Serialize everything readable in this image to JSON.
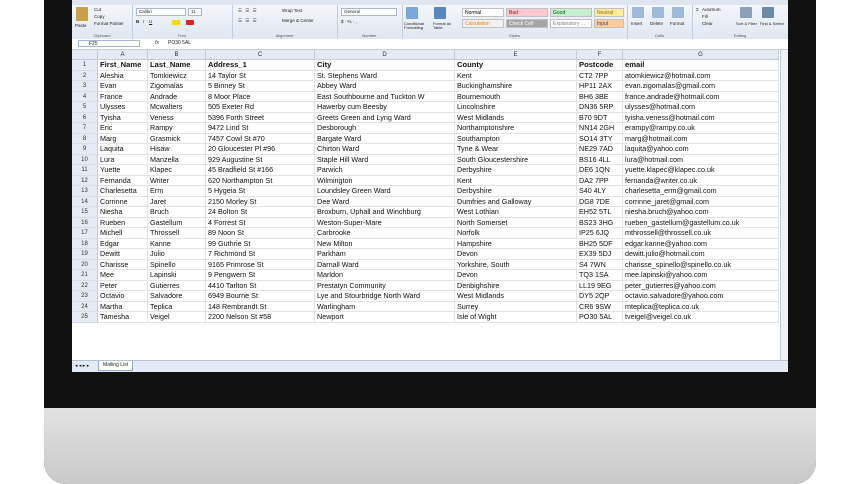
{
  "ribbon": {
    "clipboard": {
      "paste": "Paste",
      "cut": "Cut",
      "copy": "Copy",
      "format_painter": "Format Painter",
      "label": "Clipboard"
    },
    "font": {
      "name": "Calibri",
      "size": "11",
      "label": "Font"
    },
    "alignment": {
      "wrap": "Wrap Text",
      "merge": "Merge & Center",
      "label": "Alignment"
    },
    "number": {
      "format": "General",
      "label": "Number"
    },
    "styles": {
      "conditional": "Conditional Formatting",
      "format_table": "Format as Table",
      "label": "Styles",
      "items": [
        {
          "text": "Normal",
          "bg": "#ffffff",
          "fg": "#000000"
        },
        {
          "text": "Bad",
          "bg": "#ffc7ce",
          "fg": "#9c0006"
        },
        {
          "text": "Good",
          "bg": "#c6efce",
          "fg": "#006100"
        },
        {
          "text": "Neutral",
          "bg": "#ffeb9c",
          "fg": "#9c6500"
        },
        {
          "text": "Calculation",
          "bg": "#f2f2f2",
          "fg": "#fa7d00"
        },
        {
          "text": "Check Cell",
          "bg": "#a5a5a5",
          "fg": "#ffffff"
        },
        {
          "text": "Explanatory ...",
          "bg": "#ffffff",
          "fg": "#7f7f7f"
        },
        {
          "text": "Input",
          "bg": "#ffcc99",
          "fg": "#3f3f76"
        }
      ]
    },
    "cells": {
      "insert": "Insert",
      "delete": "Delete",
      "format": "Format",
      "label": "Cells"
    },
    "editing": {
      "autosum": "AutoSum",
      "fill": "Fill",
      "clear": "Clear",
      "sort": "Sort & Filter",
      "find": "Find & Select",
      "label": "Editing"
    }
  },
  "formula_bar": {
    "name_box": "F25",
    "fx": "fx",
    "value": "PO30 5AL"
  },
  "columns": [
    "A",
    "B",
    "C",
    "D",
    "E",
    "F",
    "G"
  ],
  "rows": [
    [
      "First_Name",
      "Last_Name",
      "Address_1",
      "City",
      "County",
      "Postcode",
      "email"
    ],
    [
      "Aleshia",
      "Tomkiewicz",
      "14 Taylor St",
      "St. Stephens Ward",
      "Kent",
      "CT2 7PP",
      "atomkiewicz@hotmail.com"
    ],
    [
      "Evan",
      "Zigomalas",
      "5 Binney St",
      "Abbey Ward",
      "Buckinghamshire",
      "HP11 2AX",
      "evan.zigomalas@gmail.com"
    ],
    [
      "France",
      "Andrade",
      "8 Moor Place",
      "East Southbourne and Tuckton W",
      "Bournemouth",
      "BH6 3BE",
      "france.andrade@hotmail.com"
    ],
    [
      "Ulysses",
      "Mcwalters",
      "505 Exeter Rd",
      "Hawerby cum Beesby",
      "Lincolnshire",
      "DN36 5RP",
      "ulysses@hotmail.com"
    ],
    [
      "Tyisha",
      "Veness",
      "5396 Forth Street",
      "Greets Green and Lyng Ward",
      "West Midlands",
      "B70 9DT",
      "tyisha.veness@hotmail.com"
    ],
    [
      "Eric",
      "Rampy",
      "9472 Lind St",
      "Desborough",
      "Northamptonshire",
      "NN14 2GH",
      "erampy@rampy.co.uk"
    ],
    [
      "Marg",
      "Grasmick",
      "7457 Cowl St #70",
      "Bargate Ward",
      "Southampton",
      "SO14 3TY",
      "marg@hotmail.com"
    ],
    [
      "Laquita",
      "Hisaw",
      "20 Gloucester Pl #96",
      "Chirton Ward",
      "Tyne & Wear",
      "NE29 7AD",
      "laquita@yahoo.com"
    ],
    [
      "Lura",
      "Manzella",
      "929 Augustine St",
      "Staple Hill Ward",
      "South Gloucestershire",
      "BS16 4LL",
      "lura@hotmail.com"
    ],
    [
      "Yuette",
      "Klapec",
      "45 Bradfield St #166",
      "Parwich",
      "Derbyshire",
      "DE6 1QN",
      "yuette.klapec@klapec.co.uk"
    ],
    [
      "Fernanda",
      "Writer",
      "620 Northampton St",
      "Wilmington",
      "Kent",
      "DA2 7PP",
      "fernanda@writer.co.uk"
    ],
    [
      "Charlesetta",
      "Erm",
      "5 Hygeia St",
      "Loundsley Green Ward",
      "Derbyshire",
      "S40 4LY",
      "charlesetta_erm@gmail.com"
    ],
    [
      "Corrinne",
      "Jaret",
      "2150 Morley St",
      "Dee Ward",
      "Dumfries and Galloway",
      "DG8 7DE",
      "corrinne_jaret@gmail.com"
    ],
    [
      "Niesha",
      "Bruch",
      "24 Bolton St",
      "Broxburn, Uphall and Winchburg",
      "West Lothian",
      "EH52 5TL",
      "niesha.bruch@yahoo.com"
    ],
    [
      "Rueben",
      "Gastellum",
      "4 Forrest St",
      "Weston-Super-Mare",
      "North Somerset",
      "BS23 3HG",
      "rueben_gastellum@gastellum.co.uk"
    ],
    [
      "Michell",
      "Throssell",
      "89 Noon St",
      "Carbrooke",
      "Norfolk",
      "IP25 6JQ",
      "mthrossell@throssell.co.uk"
    ],
    [
      "Edgar",
      "Kanne",
      "99 Guthrie St",
      "New Milton",
      "Hampshire",
      "BH25 5DF",
      "edgar.kanne@yahoo.com"
    ],
    [
      "Dewitt",
      "Julio",
      "7 Richmond St",
      "Parkham",
      "Devon",
      "EX39 5DJ",
      "dewitt.julio@hotmail.com"
    ],
    [
      "Charisse",
      "Spinello",
      "9165 Primrose St",
      "Darnall Ward",
      "Yorkshire, South",
      "S4 7WN",
      "charisse_spinello@spinello.co.uk"
    ],
    [
      "Mee",
      "Lapinski",
      "9 Pengwern St",
      "Marldon",
      "Devon",
      "TQ3 1SA",
      "mee.lapinski@yahoo.com"
    ],
    [
      "Peter",
      "Gutierres",
      "4410 Tarlton St",
      "Prestatyn Community",
      "Denbighshire",
      "LL19 9EG",
      "peter_gutierres@yahoo.com"
    ],
    [
      "Octavio",
      "Salvadore",
      "6949 Bourne St",
      "Lye and Stourbridge North Ward",
      "West Midlands",
      "DY5 2QP",
      "octavio.salvadore@yahoo.com"
    ],
    [
      "Martha",
      "Teplica",
      "148 Rembrandt St",
      "Warlingham",
      "Surrey",
      "CR6 9SW",
      "mteplica@teplica.co.uk"
    ],
    [
      "Tamesha",
      "Veigel",
      "2200 Nelson St #58",
      "Newport",
      "Isle of Wight",
      "PO30 5AL",
      "tveigel@veigel.co.uk"
    ]
  ],
  "sheet_tab": "Mailing List"
}
